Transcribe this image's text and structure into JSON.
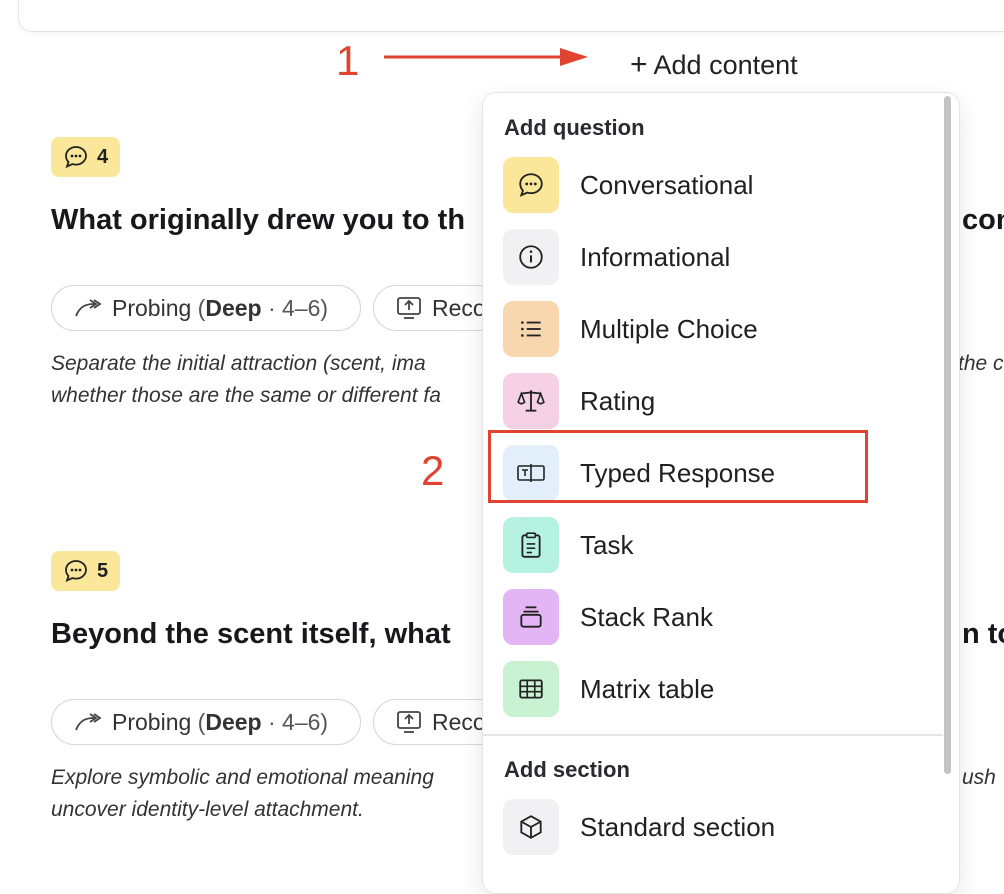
{
  "annotations": {
    "step1": "1",
    "step2": "2"
  },
  "add_content": {
    "icon": "plus-icon",
    "label": "Add content"
  },
  "questions": [
    {
      "number": "4",
      "title_left": "What originally drew you to th",
      "title_right": "con",
      "probing_label": "Probing",
      "probing_paren_open": "(",
      "probing_depth": "Deep",
      "probing_range": " · 4–6)",
      "record_label": "Reco",
      "desc_left_1": "Separate the initial attraction (scent, ima",
      "desc_right_1": "the c",
      "desc_left_2": "whether those are the same or different fa"
    },
    {
      "number": "5",
      "title_left": "Beyond the scent itself, what",
      "title_right": "n to",
      "probing_label": "Probing",
      "probing_paren_open": "(",
      "probing_depth": "Deep",
      "probing_range": " · 4–6)",
      "record_label": "Reco",
      "desc_left_1": "Explore symbolic and emotional meaning",
      "desc_right_1": "ush",
      "desc_left_2": "uncover identity-level attachment."
    }
  ],
  "menu": {
    "question_heading": "Add question",
    "items": [
      {
        "label": "Conversational",
        "icon": "chat-bubble-icon",
        "color": "#fbe79a"
      },
      {
        "label": "Informational",
        "icon": "info-icon",
        "color": "#f1f1f4"
      },
      {
        "label": "Multiple Choice",
        "icon": "list-icon",
        "color": "#f8d7ae"
      },
      {
        "label": "Rating",
        "icon": "scale-icon",
        "color": "#f6d0e4"
      },
      {
        "label": "Typed Response",
        "icon": "text-input-icon",
        "color": "#e3eefb"
      },
      {
        "label": "Task",
        "icon": "clipboard-icon",
        "color": "#b5f2e2"
      },
      {
        "label": "Stack Rank",
        "icon": "stack-icon",
        "color": "#e3b5f5"
      },
      {
        "label": "Matrix table",
        "icon": "table-icon",
        "color": "#c9f2d2"
      }
    ],
    "section_heading": "Add section",
    "section_items": [
      {
        "label": "Standard section",
        "icon": "cube-icon",
        "color": "#f1f1f4"
      }
    ]
  }
}
